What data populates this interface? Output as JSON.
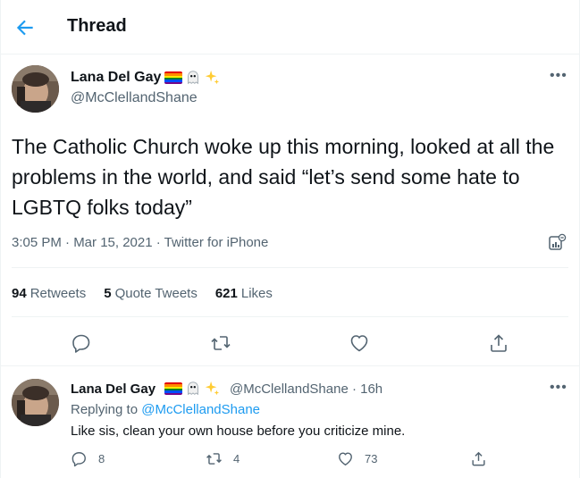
{
  "header": {
    "title": "Thread",
    "back_icon": "arrow-left-icon",
    "accent_color": "#1d9bf0"
  },
  "main_tweet": {
    "author_name": "Lana Del Gay",
    "author_handle": "@McClellandShane",
    "badges": [
      "rainbow-flag-icon",
      "ghost-icon",
      "sparkles-icon"
    ],
    "text": "The Catholic Church woke up this morning, looked at all the problems in the world, and said “let’s send some hate to LGBTQ folks today”",
    "meta": "3:05 PM · Mar 15, 2021 · Twitter for iPhone",
    "stats": [
      {
        "count": "94",
        "label": "Retweets"
      },
      {
        "count": "5",
        "label": "Quote Tweets"
      },
      {
        "count": "621",
        "label": "Likes"
      }
    ],
    "actions": [
      "reply-icon",
      "retweet-icon",
      "like-icon",
      "share-icon"
    ]
  },
  "reply_tweet": {
    "author_name": "Lana Del Gay",
    "handle_time": "@McClellandShane · 16h",
    "replying_prefix": "Replying to",
    "replying_to": "@McClellandShane",
    "text": "Like sis, clean your own house before you criticize mine.",
    "reply_count": "8",
    "retweet_count": "4",
    "like_count": "73"
  }
}
